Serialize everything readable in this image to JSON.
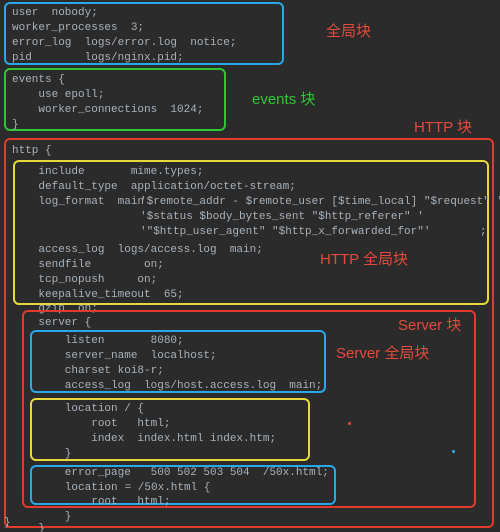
{
  "labels": {
    "global": "全局块",
    "events": "events 块",
    "http": "HTTP 块",
    "http_global": "HTTP 全局块",
    "server": "Server 块",
    "server_global": "Server 全局块"
  },
  "code": {
    "global_block": "user  nobody;\nworker_processes  3;\nerror_log  logs/error.log  notice;\npid        logs/nginx.pid;",
    "events_block": "events {\n    use epoll;\n    worker_connections  1024;\n}",
    "http_open": "http {",
    "http_global_block": "    include       mime.types;\n    default_type  application/octet-stream;\n    log_format  main ",
    "logfmt_l1": "'$remote_addr - $remote_user [$time_local] \"$request\" '",
    "logfmt_l2": "'$status $body_bytes_sent \"$http_referer\" '",
    "logfmt_l3": "'\"$http_user_agent\" \"$http_x_forwarded_for\"'",
    "semi": ";",
    "http_global_tail": "    access_log  logs/access.log  main;\n    sendfile        on;\n    tcp_nopush     on;\n    keepalive_timeout  65;\n    gzip  on;",
    "server_open": "    server {",
    "server_global_block": "        listen       8080;\n        server_name  localhost;\n        charset koi8-r;\n        access_log  logs/host.access.log  main;",
    "location_block": "        location / {\n            root   html;\n            index  index.html index.htm;\n        }",
    "error_page_line": "        error_page   500 502 503 504  /50x.html;",
    "location2_kw": "        location",
    "location2_rest": " = /50x.html {",
    "location2_tail": "            root   html;\n        }",
    "server_close": "    }",
    "http_close": "}"
  }
}
